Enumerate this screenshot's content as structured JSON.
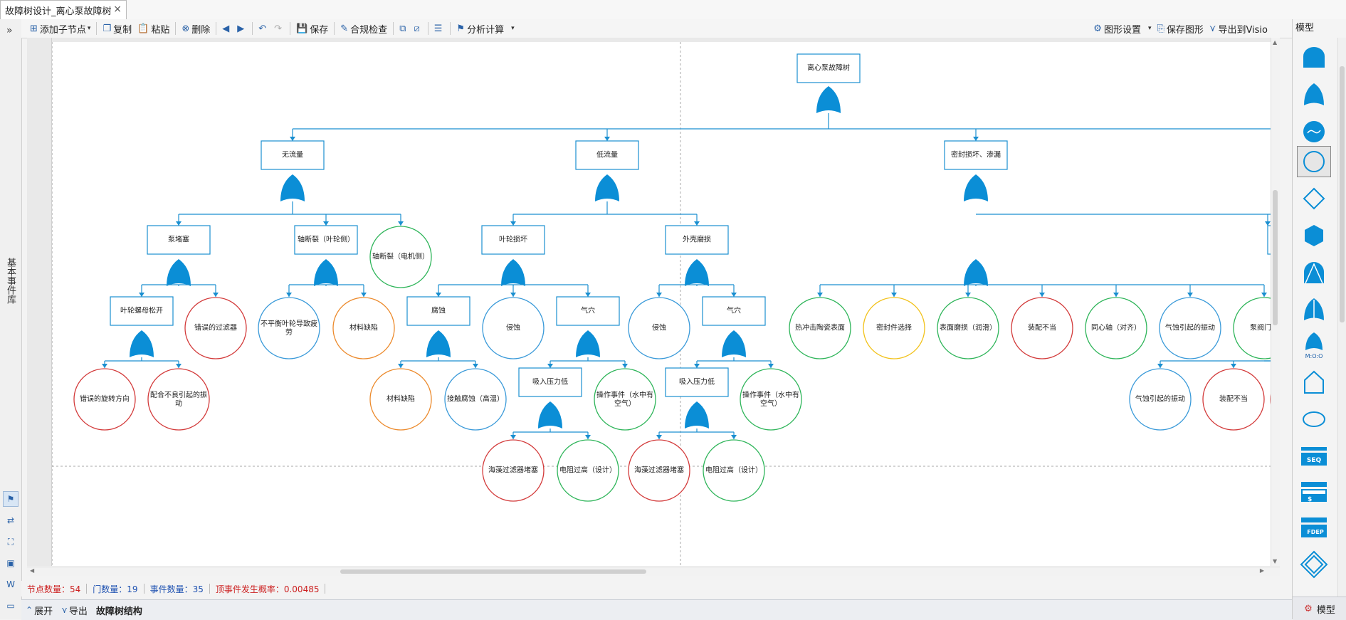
{
  "window": {
    "tab_title": "故障树设计_离心泵故障树"
  },
  "left_panel": {
    "vertical_label": "基本事件库"
  },
  "toolbar": {
    "add_child": "添加子节点",
    "copy": "复制",
    "paste": "粘贴",
    "delete": "删除",
    "save": "保存",
    "check": "合规检查",
    "analysis": "分析计算",
    "graphic_settings": "图形设置",
    "save_graphic": "保存图形",
    "export_visio": "导出到Visio"
  },
  "right_panel": {
    "title": "模型",
    "bottom_tab": "模型",
    "shape_labels": {
      "moo": "M:O:O",
      "seq": "SEQ",
      "fdep": "FDEP",
      "dollar": "$"
    }
  },
  "tree": {
    "top": {
      "label": "离心泵故障树"
    },
    "level1": [
      {
        "label": "无流量"
      },
      {
        "label": "低流量"
      },
      {
        "label": "密封损坏、渗漏"
      }
    ],
    "nodes": {
      "n_pump_block": "泵堵塞",
      "n_shaft_impeller": "轴断裂（叶轮侧）",
      "n_shaft_motor": "轴断裂（电机侧）",
      "n_impeller_dmg": "叶轮损坏",
      "n_casing_wear": "外壳磨损",
      "n_nut_loose": "叶轮螺母松开",
      "n_bad_filter": "错误的过滤器",
      "n_unbalance": "不平衡叶轮导致疲劳",
      "n_material_1": "材料缺陷",
      "n_corrosion_gate": "腐蚀",
      "n_erosion_1": "侵蚀",
      "n_cavitation_1": "气穴",
      "n_erosion_2": "侵蚀",
      "n_cavitation_2": "气穴",
      "n_thermal_shock": "热冲击陶瓷表面",
      "n_seal_select": "密封件选择",
      "n_surface_wear": "表面磨损（润滑）",
      "n_assembly_1": "装配不当",
      "n_coaxial": "同心轴（对齐）",
      "n_cav_vibration": "气蚀引起的振动",
      "n_pump_valve": "泵阀门常",
      "n_wrong_rotation": "错误的旋转方向",
      "n_fit_vibration": "配合不良引起的振动",
      "n_material_2": "材料缺陷",
      "n_contact_corr": "接触腐蚀（高温）",
      "n_suction_low_1": "吸入压力低",
      "n_op_event_1": "操作事件（水中有空气）",
      "n_suction_low_2": "吸入压力低",
      "n_op_event_2": "操作事件（水中有空气）",
      "n_cav_vibration_2": "气蚀引起的振动",
      "n_assembly_2": "装配不当",
      "n_sea_filter_1": "海藻过滤器堵塞",
      "n_resistance_1": "电阻过高（设计）",
      "n_sea_filter_2": "海藻过滤器堵塞",
      "n_resistance_2": "电阻过高（设计）"
    }
  },
  "status": {
    "node_count": "节点数量：54",
    "gate_count": "门数量：19",
    "event_count": "事件数量：35",
    "top_prob": "顶事件发生概率：0.00485"
  },
  "bottom": {
    "expand": "展开",
    "export": "导出",
    "title": "故障树结构"
  },
  "colors": {
    "gate": "#0b8ed6",
    "line": "#1a8fd0",
    "red": "#d33b3b",
    "green": "#2fb55a",
    "blue": "#3a9ad9",
    "orange": "#ec8a2c",
    "yellow": "#f2c21b",
    "status_red": "#cc1f1f",
    "status_blue": "#1b4fb0"
  }
}
